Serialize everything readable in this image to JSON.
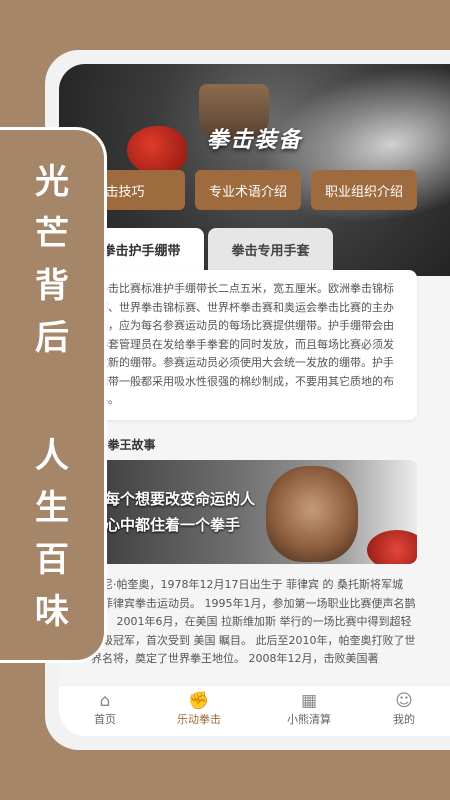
{
  "hero": {
    "title": "拳击装备"
  },
  "quick_buttons": [
    "本拳击技巧",
    "专业术语介绍",
    "职业组织介绍"
  ],
  "tabs": {
    "active": "拳击护手绷带",
    "inactive": "拳击专用手套"
  },
  "info_text": "拳击比赛标准护手绷带长二点五米，宽五厘米。欧洲拳击锦标赛、世界拳击锦标赛、世界杯拳击赛和奥运会拳击比赛的主办国，应为每名参赛运动员的每场比赛提供绷带。护手绷带会由拳套管理员在发给拳手拳套的同时发放，而且每场比赛必须发放新的绷带。参赛运动员必须使用大会统一发放的绷带。护手绷带一般都采用吸水性很强的棉纱制成，不要用其它质地的布料。",
  "section_title": "背后·拳王故事",
  "photo_caption": {
    "line1": "每个想要改变命运的人",
    "line2": "心中都住着一个拳手"
  },
  "story_text": "曼尼·帕奎奥，1978年12月17日出生于 菲律宾 的 桑托斯将军城 ，菲律宾拳击运动员。 1995年1月，参加第一场职业比赛便声名鹊起。 2001年6月，在美国 拉斯维加斯 举行的一场比赛中得到超轻量级冠军，首次受到 美国 瞩目。 此后至2010年，帕奎奥打败了世界名将，奠定了世界拳王地位。 2008年12月，击败美国著",
  "tabbar": [
    {
      "label": "首页",
      "icon": "home-icon"
    },
    {
      "label": "乐动拳击",
      "icon": "boxing-icon"
    },
    {
      "label": "小熊清算",
      "icon": "calculator-icon"
    },
    {
      "label": "我的",
      "icon": "profile-icon"
    }
  ],
  "badge": {
    "line1": "光芒背后",
    "line2": "人生百味"
  },
  "colors": {
    "accent": "#9e6b3f",
    "background": "#a58669"
  }
}
